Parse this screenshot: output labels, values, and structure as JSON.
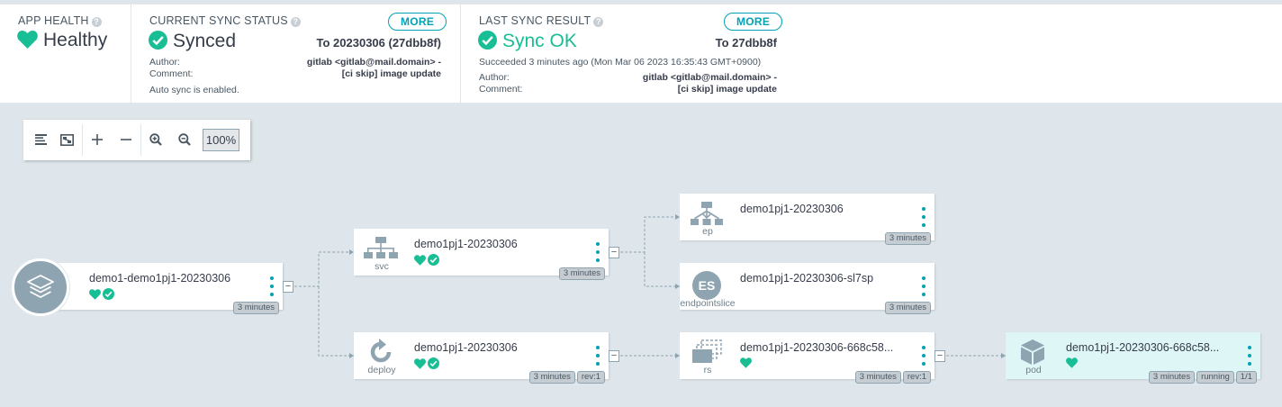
{
  "colors": {
    "healthy": "#18be94",
    "accent": "#00a2b3",
    "icon_gray": "#8fa4b1"
  },
  "app_health": {
    "title": "APP HEALTH",
    "status": "Healthy",
    "icon": "heart-icon"
  },
  "sync_status": {
    "title": "CURRENT SYNC STATUS",
    "status": "Synced",
    "more_label": "MORE",
    "to_revision": "To 20230306 (27dbb8f)",
    "author_label": "Author:",
    "author_value": "gitlab <gitlab@mail.domain> -",
    "comment_label": "Comment:",
    "comment_value": "[ci skip] image update",
    "auto_sync": "Auto sync is enabled."
  },
  "sync_result": {
    "title": "LAST SYNC RESULT",
    "status": "Sync OK",
    "more_label": "MORE",
    "to_revision": "To 27dbb8f",
    "succeeded": "Succeeded 3 minutes ago (Mon Mar 06 2023 16:35:43 GMT+0900)",
    "author_label": "Author:",
    "author_value": "gitlab <gitlab@mail.domain> -",
    "comment_label": "Comment:",
    "comment_value": "[ci skip] image update"
  },
  "toolbar": {
    "zoom": "100%",
    "buttons": [
      "tree-view-icon",
      "graph-view-icon",
      "expand-icon",
      "collapse-icon",
      "zoom-in-icon",
      "zoom-out-icon"
    ]
  },
  "nodes": {
    "app": {
      "name": "demo1-demo1pj1-20230306",
      "tags": [
        "3 minutes"
      ]
    },
    "svc": {
      "kind": "svc",
      "name": "demo1pj1-20230306",
      "tags": [
        "3 minutes"
      ]
    },
    "deploy": {
      "kind": "deploy",
      "name": "demo1pj1-20230306",
      "tags": [
        "3 minutes",
        "rev:1"
      ]
    },
    "ep": {
      "kind": "ep",
      "name": "demo1pj1-20230306",
      "tags": [
        "3 minutes"
      ]
    },
    "endpointslice": {
      "kind": "endpointslice",
      "icon_text": "ES",
      "name": "demo1pj1-20230306-sl7sp",
      "tags": [
        "3 minutes"
      ]
    },
    "rs": {
      "kind": "rs",
      "name": "demo1pj1-20230306-668c58...",
      "tags": [
        "3 minutes",
        "rev:1"
      ]
    },
    "pod": {
      "kind": "pod",
      "name": "demo1pj1-20230306-668c58...",
      "tags": [
        "3 minutes",
        "running",
        "1/1"
      ]
    }
  },
  "collapse_symbol": "−"
}
